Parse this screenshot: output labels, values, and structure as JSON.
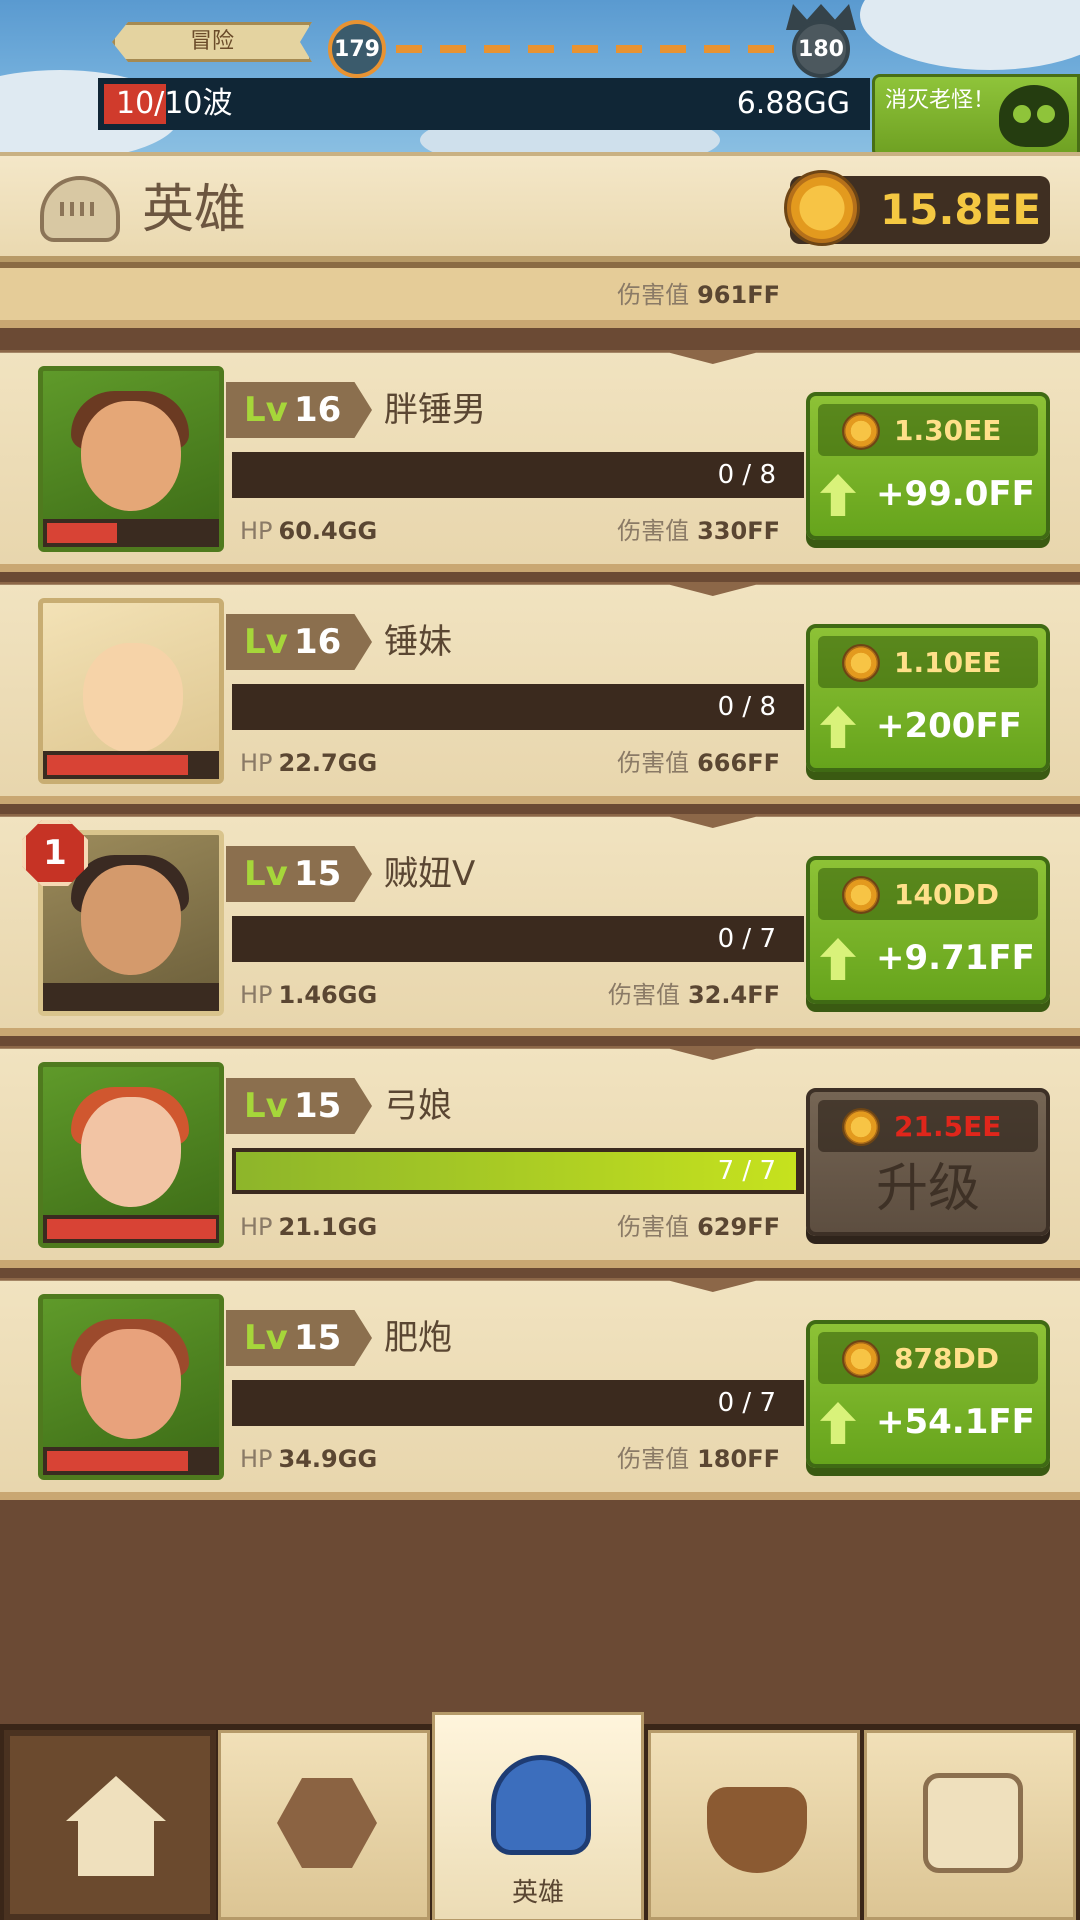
{
  "stage": {
    "label": "冒险",
    "current": "179",
    "next": "180",
    "wave_text": "10/10波",
    "wave_gold": "6.88GG",
    "boss_button": "消灭老怪！"
  },
  "header": {
    "title": "英雄",
    "gold": "15.8EE"
  },
  "partial_row": {
    "damage_label": "伤害值",
    "damage_value": "961FF"
  },
  "heroes": [
    {
      "lv_prefix": "Lv",
      "level": "16",
      "name": "胖锤男",
      "progress_text": "0 / 8",
      "progress": 0.0,
      "hp_label": "HP",
      "hp": "60.4GG",
      "damage_label": "伤害值",
      "damage": "330FF",
      "cost": "1.30EE",
      "gain": "+99.0FF"
    },
    {
      "lv_prefix": "Lv",
      "level": "16",
      "name": "锤妹",
      "progress_text": "0 / 8",
      "progress": 0.0,
      "hp_label": "HP",
      "hp": "22.7GG",
      "damage_label": "伤害值",
      "damage": "666FF",
      "cost": "1.10EE",
      "gain": "+200FF"
    },
    {
      "badge": "1",
      "lv_prefix": "Lv",
      "level": "15",
      "name": "贼妞V",
      "progress_text": "0 / 7",
      "progress": 0.0,
      "hp_label": "HP",
      "hp": "1.46GG",
      "damage_label": "伤害值",
      "damage": "32.4FF",
      "cost": "140DD",
      "gain": "+9.71FF"
    },
    {
      "lv_prefix": "Lv",
      "level": "15",
      "name": "弓娘",
      "progress_text": "7 / 7",
      "progress": 1.0,
      "hp_label": "HP",
      "hp": "21.1GG",
      "damage_label": "伤害值",
      "damage": "629FF",
      "cost": "21.5EE",
      "upgrade_label": "升级"
    },
    {
      "lv_prefix": "Lv",
      "level": "15",
      "name": "肥炮",
      "progress_text": "0 / 7",
      "progress": 0.0,
      "hp_label": "HP",
      "hp": "34.9GG",
      "damage_label": "伤害值",
      "damage": "180FF",
      "cost": "878DD",
      "gain": "+54.1FF"
    }
  ],
  "nav": {
    "tabs": [
      {
        "icon": "camp-icon"
      },
      {
        "icon": "gem-icon"
      },
      {
        "icon": "hero-helmet-icon",
        "label": "英雄"
      },
      {
        "icon": "cauldron-icon"
      },
      {
        "icon": "treasure-chest-icon"
      }
    ]
  },
  "colors": {
    "accent_green": "#8dc236",
    "gold": "#f4c842",
    "hp_red": "#d84335",
    "price_unaffordable": "#e0261b"
  }
}
